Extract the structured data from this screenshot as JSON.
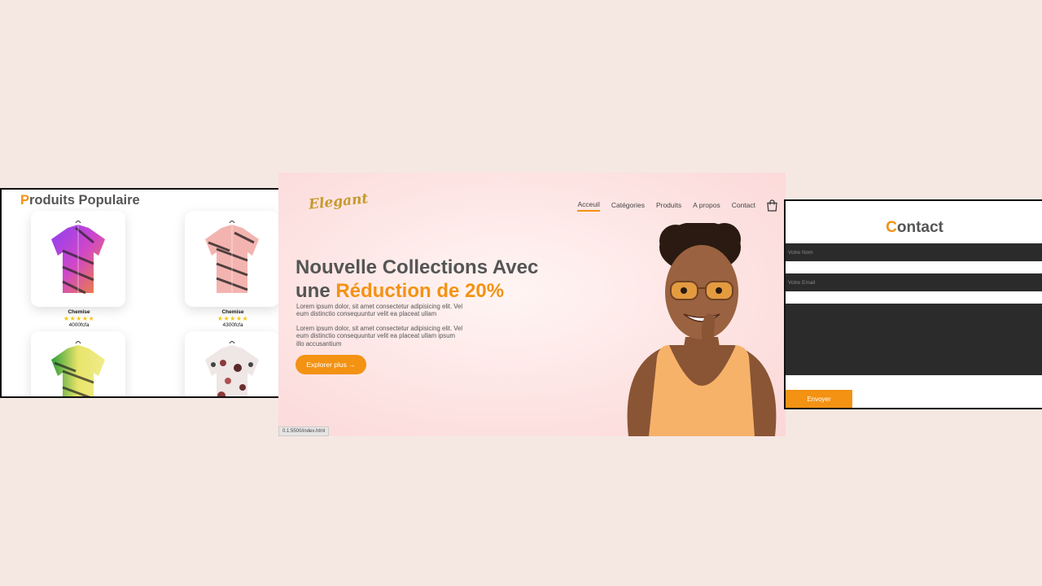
{
  "products_panel": {
    "title_first_letter": "P",
    "title_rest": "roduits Populaire",
    "items": [
      {
        "name": "Chemise",
        "stars": "★★★★★",
        "price": "4000fcfa"
      },
      {
        "name": "Chemise",
        "stars": "★★★★★",
        "price": "4300fcfa"
      },
      {
        "name": "",
        "stars": "",
        "price": ""
      },
      {
        "name": "",
        "stars": "",
        "price": ""
      }
    ]
  },
  "hero": {
    "logo": "Elegant",
    "nav": [
      "Acceuil",
      "Catégories",
      "Produits",
      "A propos",
      "Contact"
    ],
    "title_line1": "Nouvelle Collections Avec",
    "title_line2_plain": "une ",
    "title_line2_accent": "Réduction de 20%",
    "paragraph1": "Lorem ipsum dolor, sit amet consectetur adipisicing elit. Vel eum distinctio consequuntur velit ea placeat ullam",
    "paragraph2": "Lorem ipsum dolor, sit amet consectetur adipisicing elit. Vel eum distinctio consequuntur velit ea placeat ullam ipsum illo accusantium",
    "cta_label": "Explorer plus →",
    "status_url": "0.1:5500/index.html"
  },
  "contact_panel": {
    "title_first_letter": "C",
    "title_rest": "ontact",
    "name_placeholder": "Votre Nom",
    "email_placeholder": "Votre Email",
    "message_placeholder": "",
    "submit_label": "Envoyer"
  },
  "colors": {
    "accent": "#f39213",
    "page_background": "#f5e8e3",
    "heading_gray": "#555555",
    "field_dark": "#2b2b2b",
    "star_yellow": "#f5c518"
  },
  "icons": [
    "shirt-icon",
    "shopping-bag-icon",
    "arrow-right-icon",
    "star-icon"
  ]
}
